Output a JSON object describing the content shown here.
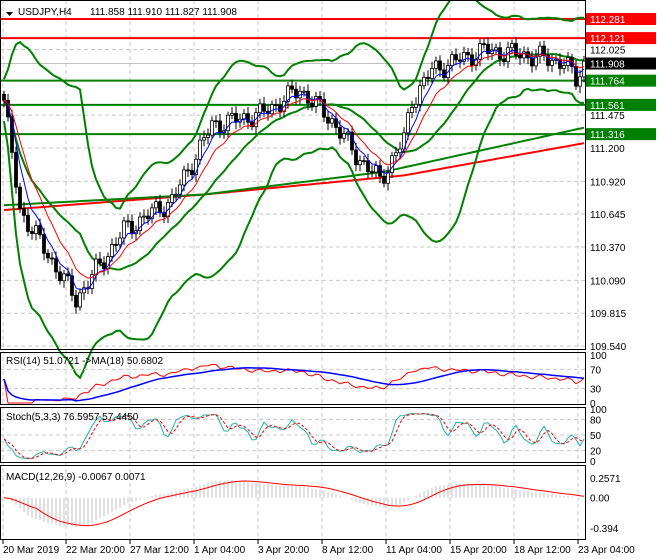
{
  "header": {
    "symbol": "USDJPY,H4",
    "ohlc": "111.858 111.910 111.827 111.908"
  },
  "colors": {
    "resistance": "#ff0000",
    "support": "#008000",
    "current": "#000000",
    "bull": "#000000",
    "bear": "#000000",
    "ma_fast": "#0000ff",
    "ma_slow": "#ff0000",
    "bands": "#008000",
    "stoch_main": "#20b2aa",
    "stoch_signal": "#ff0000",
    "macd_hist": "#c0c0c0",
    "macd_signal": "#ff0000"
  },
  "chart_data": {
    "type": "candlestick",
    "title": "USDJPY,H4",
    "x_key_bars": [
      0,
      4,
      18,
      30,
      42,
      52,
      64,
      74,
      82,
      88,
      94,
      100,
      102,
      107,
      120,
      130,
      140,
      143,
      145
    ],
    "close_key": [
      111.6,
      110.68,
      109.93,
      110.51,
      110.76,
      111.39,
      111.48,
      111.69,
      111.43,
      111.14,
      110.93,
      111.27,
      111.6,
      111.85,
      112.02,
      111.98,
      111.92,
      111.77,
      111.908
    ],
    "long_ma_red": {
      "bars": [
        0,
        50,
        100,
        145
      ],
      "values": [
        110.68,
        110.81,
        110.97,
        111.24
      ]
    },
    "long_ma_green": {
      "bars": [
        0,
        50,
        95,
        145
      ],
      "values": [
        110.72,
        110.81,
        111.0,
        111.37
      ]
    },
    "ylim": [
      109.54,
      112.281
    ],
    "y_ticks": [
      "112.025",
      "111.475",
      "111.200",
      "110.920",
      "110.645",
      "110.370",
      "110.090",
      "109.815",
      "109.540"
    ],
    "levels": [
      {
        "value": "112.281",
        "kind": "resistance"
      },
      {
        "value": "112.121",
        "kind": "resistance"
      },
      {
        "value": "111.764",
        "kind": "support"
      },
      {
        "value": "111.561",
        "kind": "support"
      },
      {
        "value": "111.316",
        "kind": "support"
      }
    ],
    "current_price": "111.908",
    "x_labels": [
      "20 Mar 2019",
      "22 Mar 20:00",
      "27 Mar 12:00",
      "1 Apr 04:00",
      "3 Apr 20:00",
      "8 Apr 12:00",
      "11 Apr 04:00",
      "15 Apr 20:00",
      "18 Apr 12:00",
      "23 Apr 04:00"
    ],
    "rsi": {
      "label": "RSI(14) 51.0721  ->MA(18) 50.6802",
      "ticks": [
        "100",
        "70",
        "30",
        "0"
      ]
    },
    "stoch": {
      "label": "Stoch(5,3,3) 76.5957 57.4450",
      "ticks": [
        "100",
        "80",
        "50",
        "20",
        "0"
      ]
    },
    "macd": {
      "label": "MACD(12,26,9) -0.0067 0.0071",
      "ticks": [
        "0.2571",
        "0.00",
        "-0.394"
      ]
    }
  }
}
